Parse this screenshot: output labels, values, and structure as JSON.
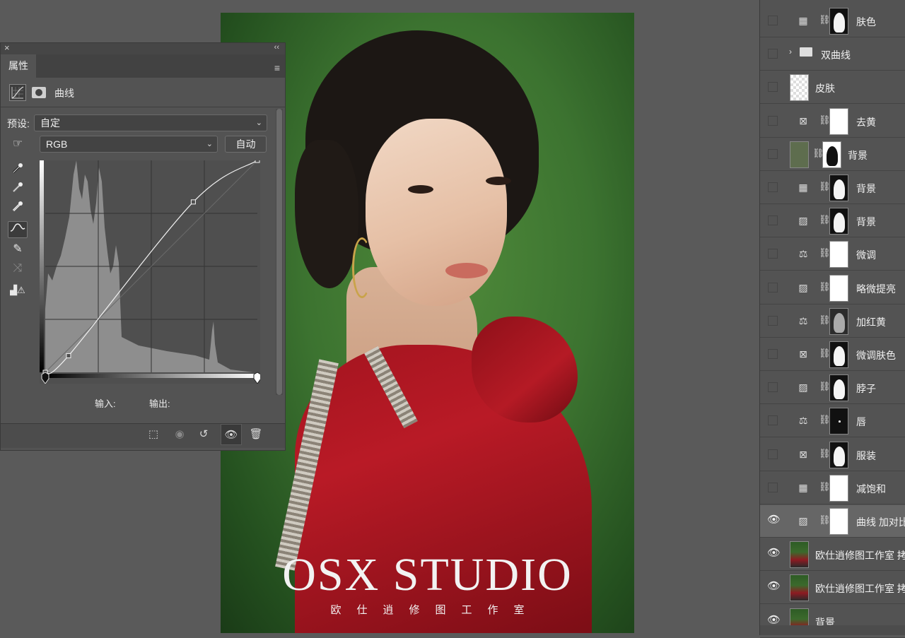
{
  "canvas": {
    "brand_title": "OSX STUDIO",
    "brand_subtitle": "欧仕逍修图工作室"
  },
  "properties": {
    "tab_label": "属性",
    "kind_label": "曲线",
    "preset_label": "预设:",
    "preset_value": "自定",
    "channel_value": "RGB",
    "auto_button": "自动",
    "input_label": "输入:",
    "output_label": "输出:",
    "tools": [
      "sample-shadow-eyedropper-icon",
      "sample-midtone-eyedropper-icon",
      "sample-highlight-eyedropper-icon",
      "edit-curve-points-icon",
      "draw-curve-pencil-icon",
      "smooth-curve-icon",
      "clipping-warning-icon"
    ]
  },
  "curve": {
    "type": "curve",
    "x_range": [
      0,
      255
    ],
    "y_range": [
      0,
      255
    ],
    "points": [
      [
        0,
        0
      ],
      [
        28,
        20
      ],
      [
        178,
        205
      ],
      [
        255,
        255
      ]
    ],
    "grid": "4x4"
  },
  "layers": [
    {
      "name": "肤色",
      "visible": false,
      "kind": "adj",
      "icon": "gradient-map-icon",
      "mask": "black"
    },
    {
      "name": "双曲线",
      "visible": false,
      "kind": "group"
    },
    {
      "name": "皮肤",
      "visible": false,
      "kind": "pixel",
      "thumb": "check"
    },
    {
      "name": "去黄",
      "visible": false,
      "kind": "adj",
      "icon": "channel-mixer-icon",
      "mask": "white-plain"
    },
    {
      "name": "背景",
      "visible": false,
      "kind": "fill",
      "mask": "white"
    },
    {
      "name": "背景",
      "visible": false,
      "kind": "adj",
      "icon": "gradient-map-icon",
      "mask": "black"
    },
    {
      "name": "背景",
      "visible": false,
      "kind": "adj",
      "icon": "curves-icon",
      "mask": "black"
    },
    {
      "name": "微调",
      "visible": false,
      "kind": "adj",
      "icon": "color-balance-icon",
      "mask": "white-plain"
    },
    {
      "name": "略微提亮",
      "visible": false,
      "kind": "adj",
      "icon": "curves-icon",
      "mask": "white-plain"
    },
    {
      "name": "加红黄",
      "visible": false,
      "kind": "adj",
      "icon": "color-balance-icon",
      "mask": "dark-photo"
    },
    {
      "name": "微调肤色",
      "visible": false,
      "kind": "adj",
      "icon": "channel-mixer-icon",
      "mask": "black"
    },
    {
      "name": "脖子",
      "visible": false,
      "kind": "adj",
      "icon": "curves-icon",
      "mask": "black"
    },
    {
      "name": "唇",
      "visible": false,
      "kind": "adj",
      "icon": "color-balance-icon",
      "mask": "black-dot"
    },
    {
      "name": "服装",
      "visible": false,
      "kind": "adj",
      "icon": "channel-mixer-icon",
      "mask": "black"
    },
    {
      "name": "减饱和",
      "visible": false,
      "kind": "adj",
      "icon": "gradient-map-icon",
      "mask": "white-plain"
    },
    {
      "name": "曲线 加对比",
      "visible": true,
      "kind": "adj",
      "icon": "curves-icon",
      "mask": "white-plain",
      "selected": true
    },
    {
      "name": "欧仕逍修图工作室 拷",
      "visible": true,
      "kind": "pixel",
      "thumb": "photo"
    },
    {
      "name": "欧仕逍修图工作室 拷",
      "visible": true,
      "kind": "pixel",
      "thumb": "photo"
    },
    {
      "name": "背景",
      "visible": true,
      "kind": "pixel",
      "thumb": "photo"
    }
  ]
}
